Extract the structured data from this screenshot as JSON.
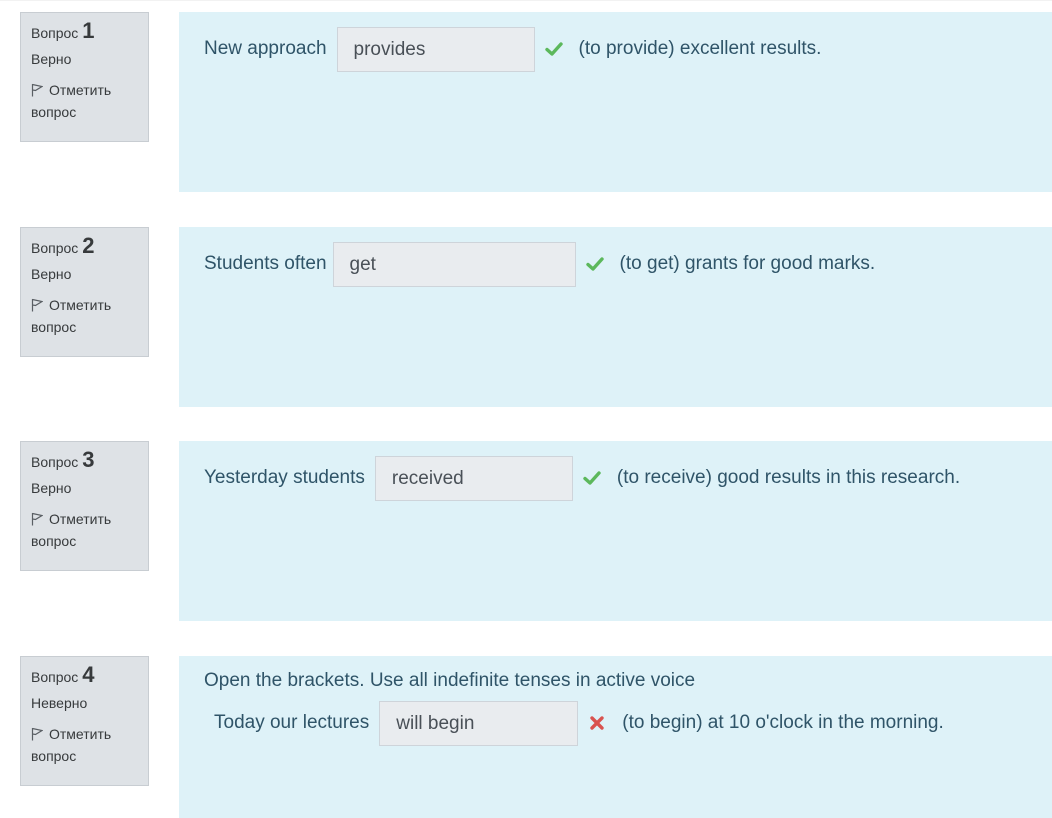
{
  "labels": {
    "question_word": "Вопрос",
    "flag_label": "Отметить вопрос"
  },
  "colors": {
    "correct": "#5cb85c",
    "incorrect": "#d9534f",
    "content_bg": "#def2f8",
    "info_bg": "#dee2e6"
  },
  "questions": [
    {
      "number": "1",
      "state": "Верно",
      "before": "New approach",
      "answer": "provides",
      "after": "(to provide) excellent results.",
      "mark_icon": "check-icon"
    },
    {
      "number": "2",
      "state": "Верно",
      "before": "Students often",
      "answer": "get",
      "after": "(to get) grants for good marks.",
      "mark_icon": "check-icon"
    },
    {
      "number": "3",
      "state": "Верно",
      "before": "Yesterday students",
      "answer": "received",
      "after": "(to receive) good results in this research.",
      "mark_icon": "check-icon"
    },
    {
      "number": "4",
      "state": "Неверно",
      "instruction": "Open the brackets. Use all indefinite tenses in active voice",
      "before": "Today our lectures",
      "answer": "will begin",
      "after": "(to begin) at 10 o'clock in the morning.",
      "mark_icon": "cross-icon"
    }
  ]
}
